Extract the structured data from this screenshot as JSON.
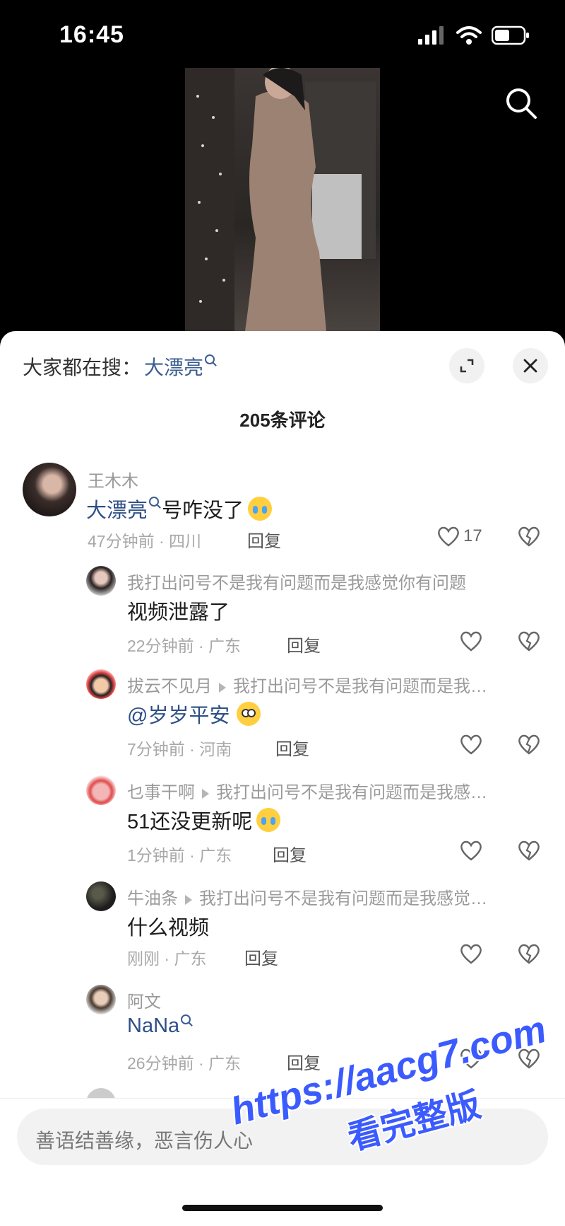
{
  "status_bar": {
    "time": "16:45"
  },
  "suggest": {
    "prefix": "大家都在搜：",
    "keyword": "大漂亮"
  },
  "comment_count": "205条评论",
  "comments": [
    {
      "name": "王木木",
      "text": "大漂亮",
      "text_suffix": "号咋没了",
      "emoji": "crying-emoji",
      "meta": "47分钟前 · 四川",
      "reply": "回复",
      "likes": "17"
    },
    {
      "name": "我打出问号不是我有问题而是我感觉你有问题",
      "text": "视频泄露了",
      "meta": "22分钟前 · 广东",
      "reply": "回复"
    },
    {
      "name": "拔云不见月",
      "reply_to": "我打出问号不是我有问题而是我…",
      "text": "@岁岁平安",
      "emoji": "wow-emoji",
      "meta": "7分钟前 · 河南",
      "reply": "回复"
    },
    {
      "name": "乜事干啊",
      "reply_to": "我打出问号不是我有问题而是我感…",
      "text": "51还没更新呢",
      "emoji": "crying-emoji",
      "meta": "1分钟前 · 广东",
      "reply": "回复"
    },
    {
      "name": "牛油条",
      "reply_to": "我打出问号不是我有问题而是我感觉…",
      "text": "什么视频",
      "meta": "刚刚 · 广东",
      "reply": "回复"
    },
    {
      "name": "阿文",
      "text": "NaNa",
      "meta": "26分钟前 · 广东",
      "reply": "回复"
    }
  ],
  "input": {
    "placeholder": "善语结善缘，恶言伤人心"
  },
  "watermark": {
    "line1": "https://aacg7.com",
    "line2": "看完整版"
  }
}
